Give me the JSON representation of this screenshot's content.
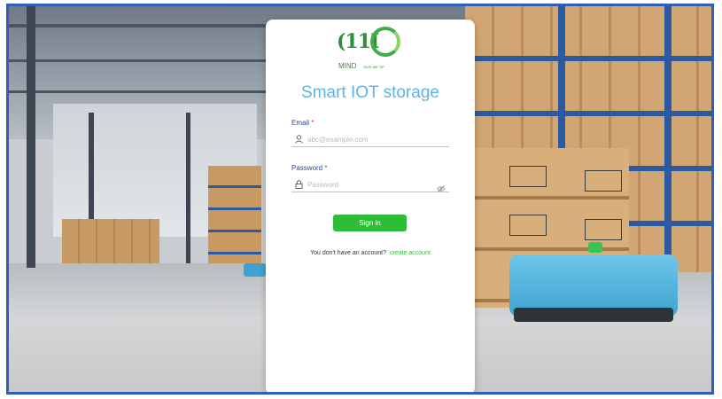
{
  "brand": {
    "logo_mark": "(11I",
    "logo_name": "MIND",
    "logo_tagline": "GIVE ME TIP",
    "app_title": "Smart IOT storage"
  },
  "form": {
    "email": {
      "label": "Email",
      "required_mark": "*",
      "placeholder": "abc@example.com",
      "icon": "user-icon"
    },
    "password": {
      "label": "Password",
      "required_mark": "*",
      "placeholder": "Password",
      "icon": "lock-icon",
      "toggle_icon": "eye-off-icon"
    },
    "sign_in_label": "Sign in",
    "signup_prompt": "You don't have an account?",
    "create_account_label": "create account"
  },
  "colors": {
    "accent_green": "#2ebd38",
    "title_blue": "#5cb4e6",
    "label_blue": "#2b4a8a",
    "required_red": "#e0313a",
    "frame_blue": "#2f5fb8"
  }
}
